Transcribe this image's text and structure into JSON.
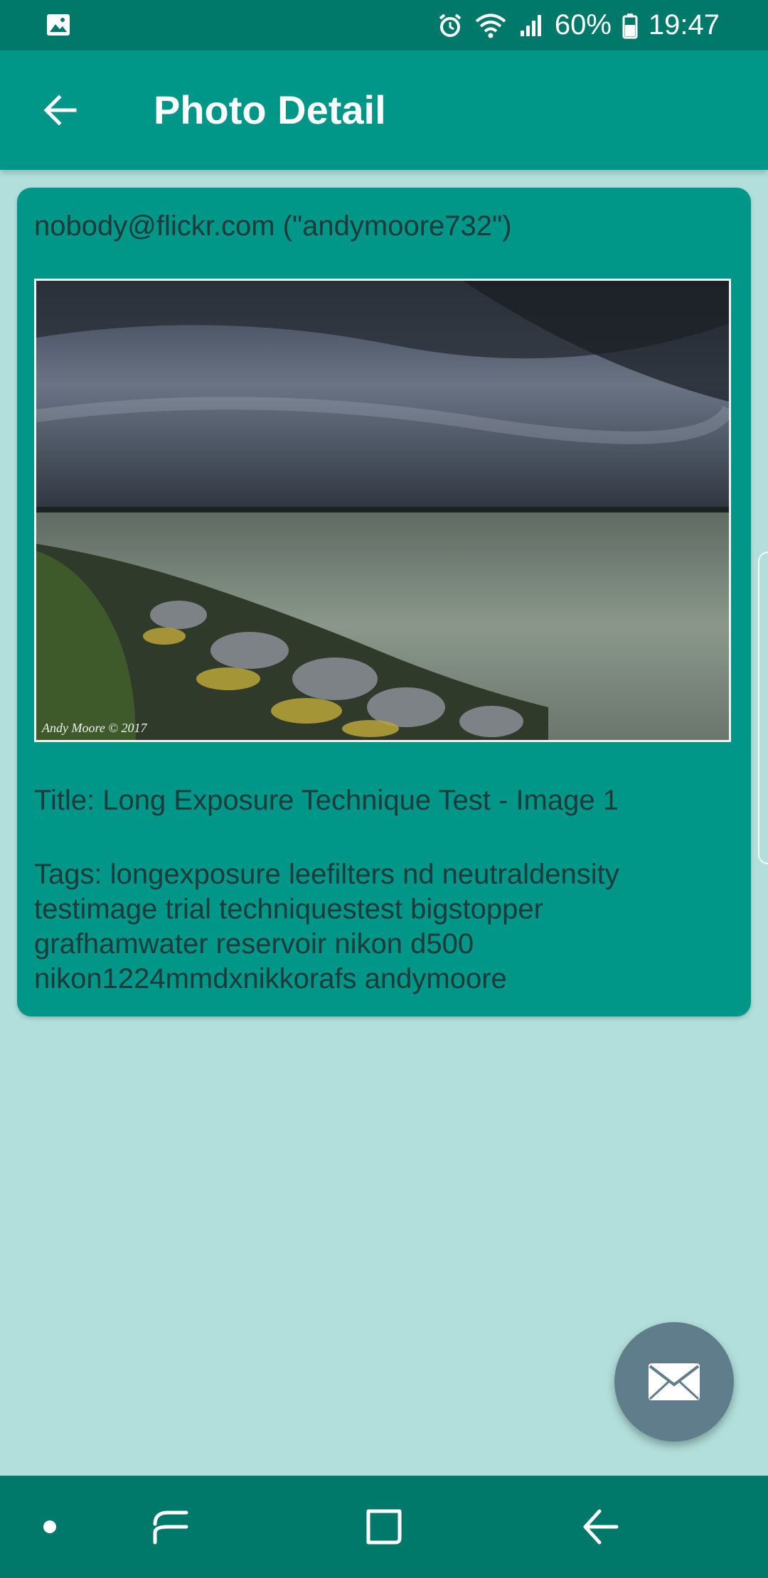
{
  "status_bar": {
    "battery": "60%",
    "time": "19:47",
    "icons": [
      "image-icon",
      "alarm-icon",
      "wifi-icon",
      "signal-icon",
      "battery-icon"
    ]
  },
  "app_bar": {
    "title": "Photo Detail",
    "back_icon": "arrow-back-icon"
  },
  "photo": {
    "author": "nobody@flickr.com (\"andymoore732\")",
    "watermark": "Andy Moore © 2017",
    "title": "Title: Long Exposure Technique Test - Image 1",
    "tags": "Tags: longexposure leefilters nd neutraldensity testimage trial techniquestest bigstopper grafhamwater reservoir nikon d500 nikon1224mmdxnikkorafs andymoore"
  },
  "fab": {
    "icon": "mail-icon"
  },
  "nav_bar": {
    "items": [
      "dot-icon",
      "recents-icon",
      "home-icon",
      "back-icon"
    ]
  },
  "colors": {
    "status_bar": "#00796b",
    "app_bar": "#009688",
    "background": "#b2dfdb",
    "card": "#009688",
    "fab": "#607d8b",
    "nav_bar": "#00796b"
  }
}
